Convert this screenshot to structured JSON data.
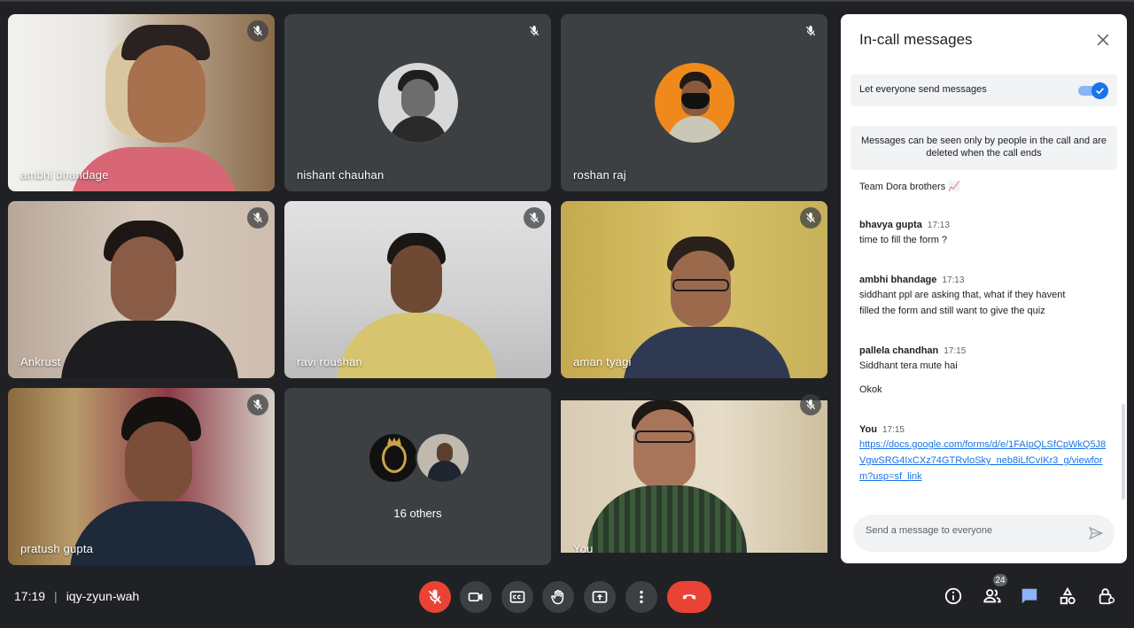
{
  "tiles": [
    {
      "name": "ambhi bhandage"
    },
    {
      "name": "nishant chauhan"
    },
    {
      "name": "roshan raj"
    },
    {
      "name": "Ankrust"
    },
    {
      "name": "ravi roushan"
    },
    {
      "name": "aman tyagi"
    },
    {
      "name": "pratush gupta"
    },
    {
      "name": "16 others"
    },
    {
      "name": "You"
    }
  ],
  "panel": {
    "title": "In-call messages",
    "toggle_label": "Let everyone send messages",
    "toggle_on": true,
    "info": "Messages can be seen only by people in the call and are deleted when the call ends",
    "messages": [
      {
        "sender": "",
        "time": "",
        "lines": [
          "Team Dora brothers 📈"
        ]
      },
      {
        "sender": "bhavya gupta",
        "time": "17:13",
        "lines": [
          "time to fill the form ?"
        ]
      },
      {
        "sender": "ambhi bhandage",
        "time": "17:13",
        "lines": [
          "siddhant ppl are asking that, what if they havent",
          "filled the form and still want to give the quiz"
        ]
      },
      {
        "sender": "pallela chandhan",
        "time": "17:15",
        "lines": [
          "Siddhant tera mute hai",
          "Okok"
        ]
      },
      {
        "sender": "You",
        "time": "17:15",
        "link": "https://docs.google.com/forms/d/e/1FAIpQLSfCpWkQ5J8VgwSRG4IxCXz74GTRvloSky_neb8iLfCvIKr3_g/viewform?usp=sf_link"
      }
    ],
    "compose_placeholder": "Send a message to everyone"
  },
  "bottom": {
    "time": "17:19",
    "separator": "|",
    "meeting_code": "iqy-zyun-wah",
    "participant_count": "24"
  },
  "colors": {
    "background": "#202124",
    "tile": "#3c4043",
    "accent_red": "#ea4335",
    "accent_blue": "#1a73e8"
  }
}
